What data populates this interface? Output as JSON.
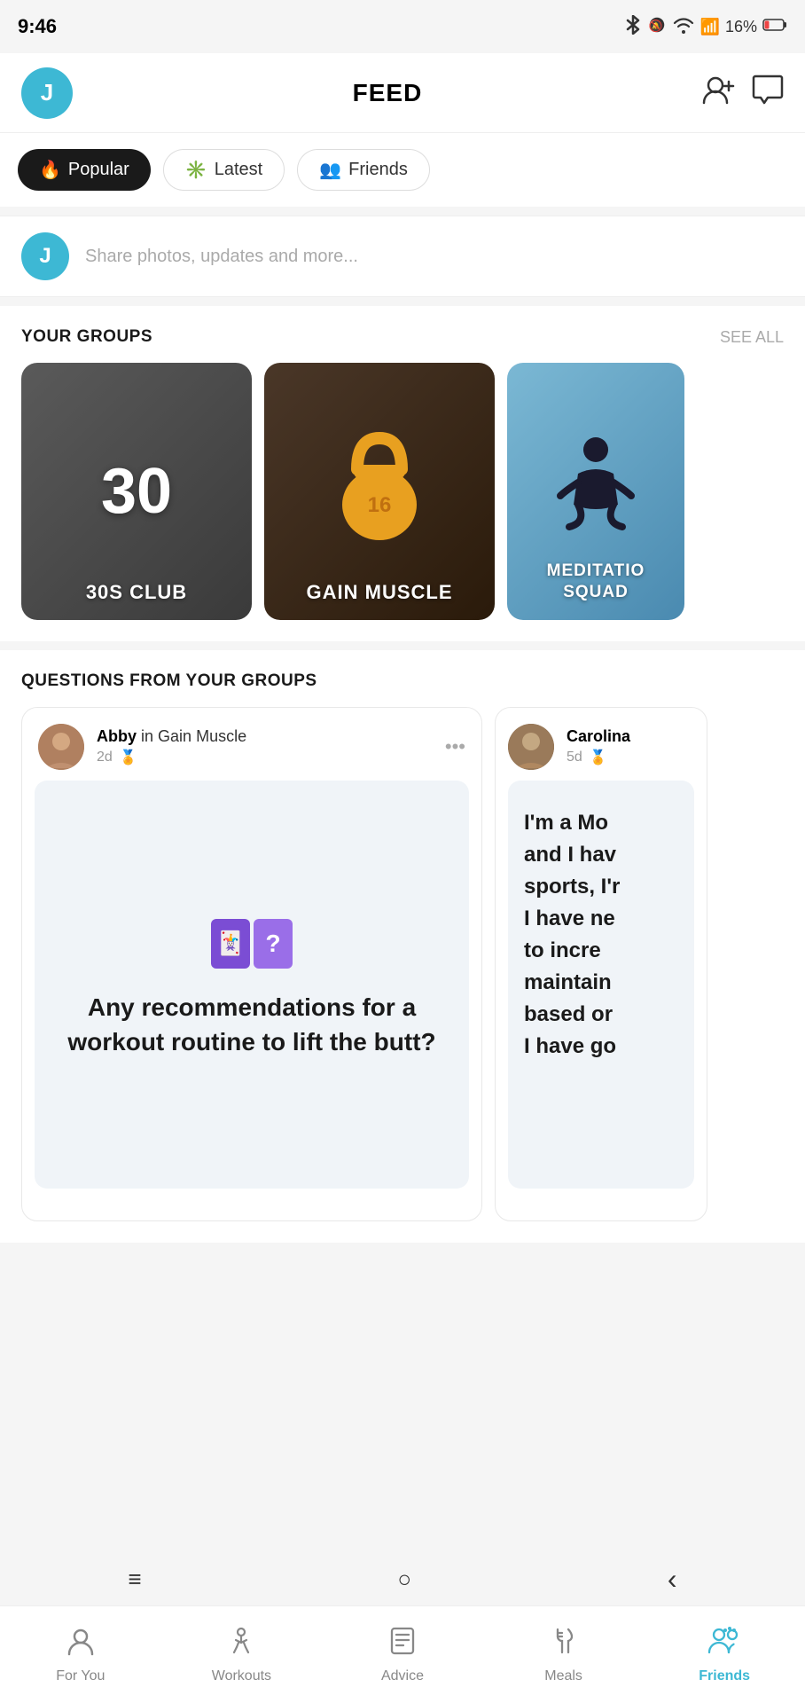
{
  "statusBar": {
    "time": "9:46",
    "battery": "16%",
    "batteryIcon": "🔋"
  },
  "header": {
    "avatarLetter": "J",
    "title": "FEED",
    "addFriendLabel": "add-friend",
    "chatLabel": "chat"
  },
  "filters": [
    {
      "id": "popular",
      "label": "Popular",
      "icon": "🔥",
      "active": true
    },
    {
      "id": "latest",
      "label": "Latest",
      "icon": "✳️",
      "active": false
    },
    {
      "id": "friends",
      "label": "Friends",
      "icon": "👥",
      "active": false
    }
  ],
  "sharePlaceholder": "Share photos, updates and more...",
  "shareAvatarLetter": "J",
  "groups": {
    "sectionTitle": "YOUR GROUPS",
    "seeAllLabel": "SEE ALL",
    "items": [
      {
        "id": "30s-club",
        "type": "number",
        "number": "30",
        "label": "30S CLUB"
      },
      {
        "id": "gain-muscle",
        "type": "kettlebell",
        "label": "GAIN MUSCLE"
      },
      {
        "id": "meditation-squad",
        "type": "meditation",
        "label": "MEDITATIO...\nSQUAD"
      }
    ]
  },
  "questions": {
    "sectionTitle": "QUESTIONS FROM YOUR GROUPS",
    "cards": [
      {
        "id": "abby-card",
        "userName": "Abby",
        "preposition": "in",
        "groupName": "Gain Muscle",
        "timeAgo": "2d",
        "questionText": "Any recommendations for a workout routine to lift the butt?"
      },
      {
        "id": "carolina-card",
        "userName": "Carolina",
        "timeAgo": "5d",
        "partialText": "I'm a Mo... and I hav... sports, I'r... I have ne... to incre... maintain... based or... I have go..."
      }
    ]
  },
  "bottomNav": {
    "items": [
      {
        "id": "for-you",
        "label": "For You",
        "icon": "person",
        "active": false
      },
      {
        "id": "workouts",
        "label": "Workouts",
        "icon": "figure",
        "active": false
      },
      {
        "id": "advice",
        "label": "Advice",
        "icon": "document",
        "active": false
      },
      {
        "id": "meals",
        "label": "Meals",
        "icon": "fork-knife",
        "active": false
      },
      {
        "id": "friends",
        "label": "Friends",
        "icon": "people",
        "active": true
      }
    ]
  },
  "systemNav": {
    "menuIcon": "≡",
    "homeIcon": "○",
    "backIcon": "‹"
  }
}
